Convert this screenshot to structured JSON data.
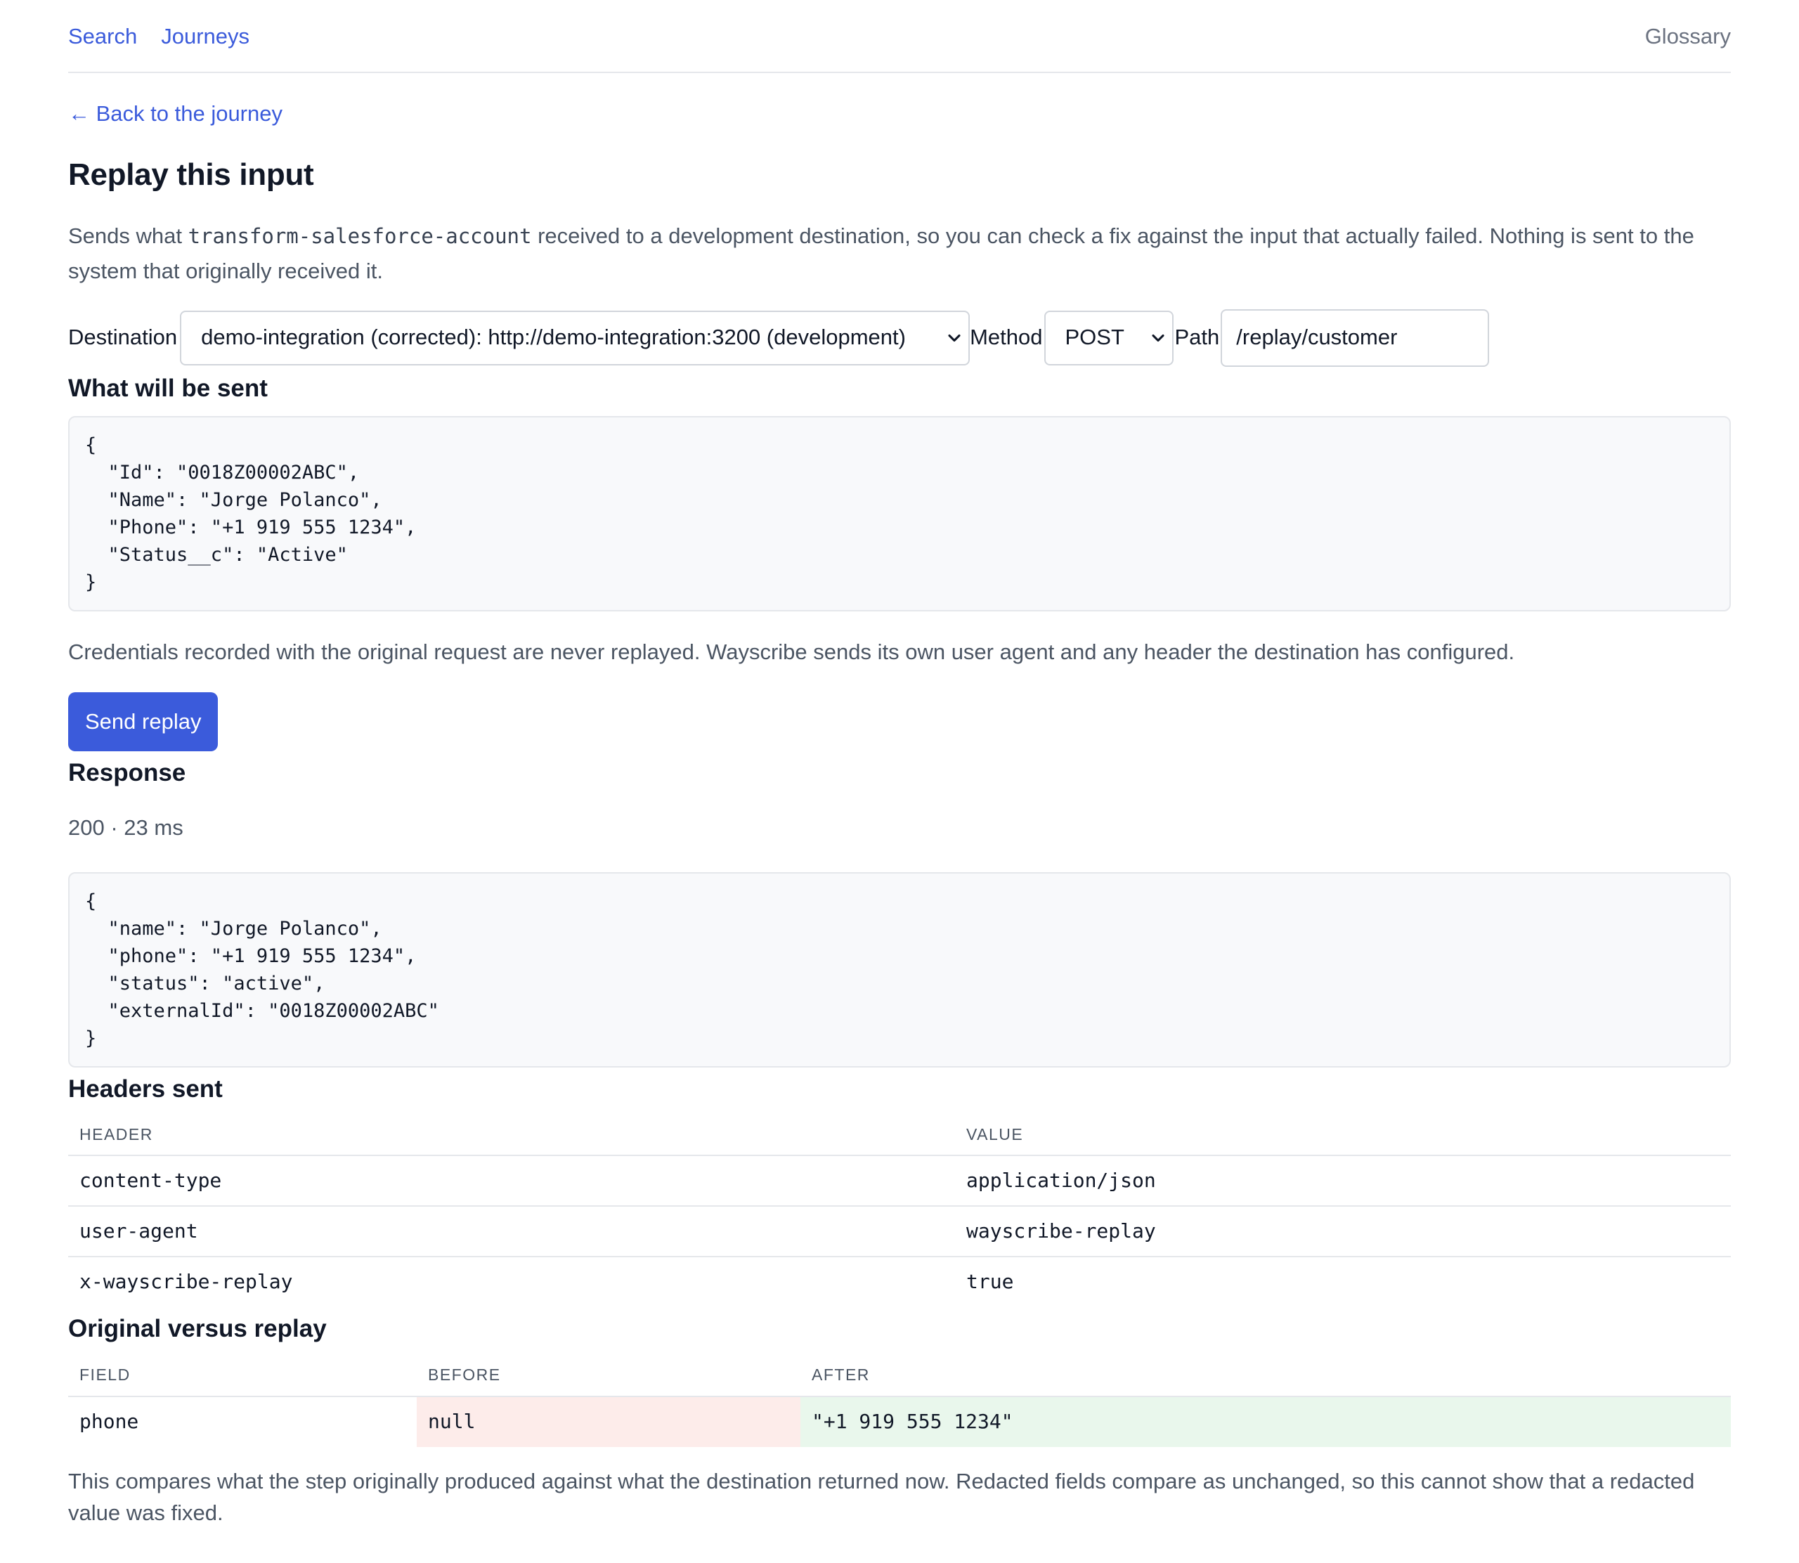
{
  "nav": {
    "links": [
      "Search",
      "Journeys"
    ],
    "glossary": "Glossary"
  },
  "back_link": "← Back to the journey",
  "page_title": "Replay this input",
  "intro": {
    "prefix": "Sends what ",
    "code": "transform-salesforce-account",
    "suffix": " received to a development destination, so you can check a fix against the input that actually failed. Nothing is sent to the system that originally received it."
  },
  "controls": {
    "destination_label": "Destination",
    "destination_value": "demo-integration (corrected): http://demo-integration:3200 (development)",
    "method_label": "Method",
    "method_value": "POST",
    "path_label": "Path",
    "path_value": "/replay/customer"
  },
  "payload": {
    "heading": "What will be sent",
    "body": "{\n  \"Id\": \"0018Z00002ABC\",\n  \"Name\": \"Jorge Polanco\",\n  \"Phone\": \"+1 919 555 1234\",\n  \"Status__c\": \"Active\"\n}"
  },
  "credentials_note": "Credentials recorded with the original request are never replayed. Wayscribe sends its own user agent and any header the destination has configured.",
  "send_button": "Send replay",
  "response": {
    "heading": "Response",
    "status": "200 · 23 ms",
    "body": "{\n  \"name\": \"Jorge Polanco\",\n  \"phone\": \"+1 919 555 1234\",\n  \"status\": \"active\",\n  \"externalId\": \"0018Z00002ABC\"\n}"
  },
  "headers_sent": {
    "heading": "Headers sent",
    "columns": [
      "Header",
      "Value"
    ],
    "rows": [
      [
        "content-type",
        "application/json"
      ],
      [
        "user-agent",
        "wayscribe-replay"
      ],
      [
        "x-wayscribe-replay",
        "true"
      ]
    ]
  },
  "comparison": {
    "heading": "Original versus replay",
    "columns": [
      "Field",
      "Before",
      "After"
    ],
    "rows": [
      [
        "phone",
        "null",
        "\"+1 919 555 1234\""
      ]
    ],
    "footnote": "This compares what the step originally produced against what the destination returned now. Redacted fields compare as unchanged, so this cannot show that a redacted value was fixed."
  },
  "colors": {
    "accent": "#3b5bdb",
    "before_bg": "#fdecea",
    "after_bg": "#e9f7ec"
  }
}
